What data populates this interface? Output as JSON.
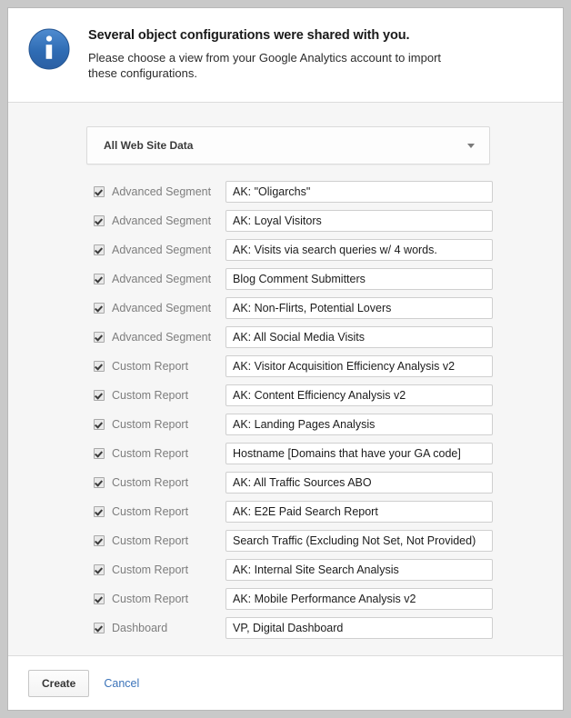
{
  "dialog": {
    "icon": "info-circle-icon",
    "title": "Several object configurations were shared with you.",
    "subtitle": "Please choose a view from your Google Analytics account to import these configurations."
  },
  "view_select": {
    "label": "All Web Site Data",
    "caret_icon": "chevron-down-icon"
  },
  "items": [
    {
      "checked": true,
      "type": "Advanced Segment",
      "name": "AK: \"Oligarchs\""
    },
    {
      "checked": true,
      "type": "Advanced Segment",
      "name": "AK: Loyal Visitors"
    },
    {
      "checked": true,
      "type": "Advanced Segment",
      "name": "AK: Visits via search queries w/ 4 words."
    },
    {
      "checked": true,
      "type": "Advanced Segment",
      "name": "Blog Comment Submitters"
    },
    {
      "checked": true,
      "type": "Advanced Segment",
      "name": "AK: Non-Flirts, Potential Lovers"
    },
    {
      "checked": true,
      "type": "Advanced Segment",
      "name": "AK: All Social Media Visits"
    },
    {
      "checked": true,
      "type": "Custom Report",
      "name": "AK: Visitor Acquisition Efficiency Analysis v2"
    },
    {
      "checked": true,
      "type": "Custom Report",
      "name": "AK: Content Efficiency Analysis v2"
    },
    {
      "checked": true,
      "type": "Custom Report",
      "name": "AK: Landing Pages Analysis"
    },
    {
      "checked": true,
      "type": "Custom Report",
      "name": "Hostname [Domains that have your GA code]"
    },
    {
      "checked": true,
      "type": "Custom Report",
      "name": "AK: All Traffic Sources ABO"
    },
    {
      "checked": true,
      "type": "Custom Report",
      "name": "AK: E2E Paid Search Report"
    },
    {
      "checked": true,
      "type": "Custom Report",
      "name": "Search Traffic (Excluding Not Set, Not Provided)"
    },
    {
      "checked": true,
      "type": "Custom Report",
      "name": "AK: Internal Site Search Analysis"
    },
    {
      "checked": true,
      "type": "Custom Report",
      "name": "AK: Mobile Performance Analysis v2"
    },
    {
      "checked": true,
      "type": "Dashboard",
      "name": "VP, Digital Dashboard"
    }
  ],
  "footer": {
    "create_label": "Create",
    "cancel_label": "Cancel"
  },
  "colors": {
    "info_blue": "#2f6cb4",
    "link_blue": "#3b73b9",
    "body_bg": "#f6f6f6",
    "label_gray": "#7d7d7d"
  }
}
